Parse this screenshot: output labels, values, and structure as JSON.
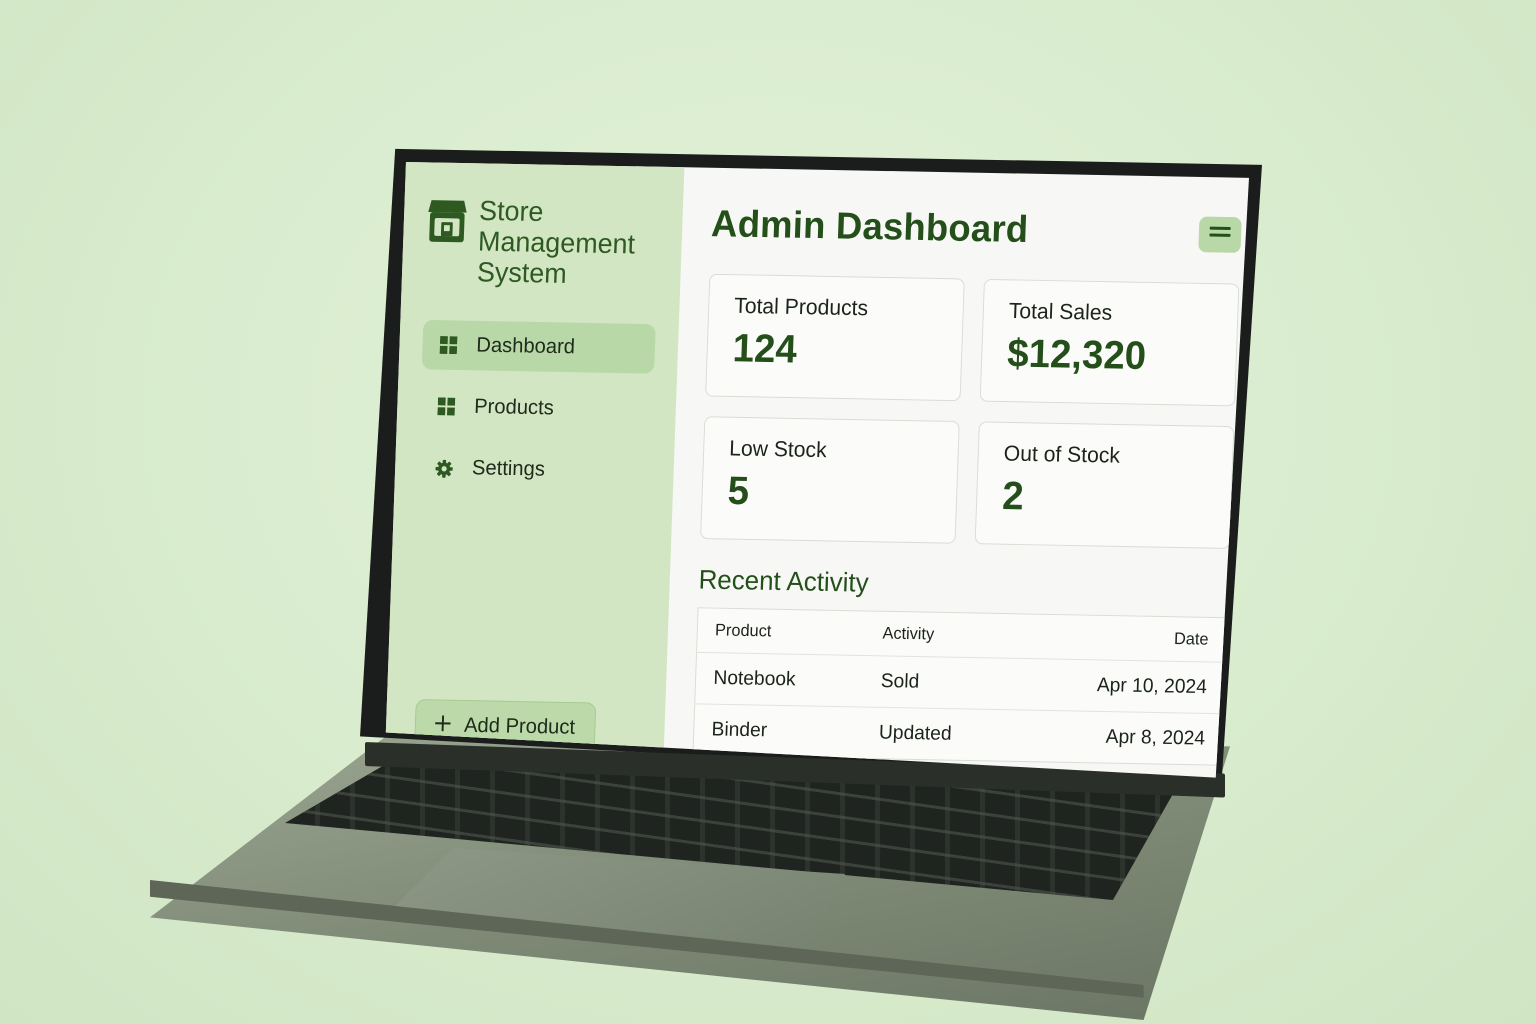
{
  "brand": {
    "title": "Store\nManagement\nSystem",
    "icon": "storefront-icon"
  },
  "nav": {
    "items": [
      {
        "label": "Dashboard",
        "icon": "grid-icon",
        "active": true
      },
      {
        "label": "Products",
        "icon": "grid-icon",
        "active": false
      },
      {
        "label": "Settings",
        "icon": "gear-icon",
        "active": false
      }
    ]
  },
  "sidebar": {
    "add_product_label": "Add Product",
    "add_icon": "plus-icon"
  },
  "header": {
    "title": "Admin Dashboard",
    "menu_icon": "hamburger-icon"
  },
  "stats": [
    {
      "label": "Total Products",
      "value": "124"
    },
    {
      "label": "Total Sales",
      "value": "$12,320"
    },
    {
      "label": "Low Stock",
      "value": "5"
    },
    {
      "label": "Out of Stock",
      "value": "2"
    }
  ],
  "activity": {
    "title": "Recent Activity",
    "columns": [
      "Product",
      "Activity",
      "Date"
    ],
    "rows": [
      {
        "product": "Notebook",
        "activity": "Sold",
        "date": "Apr 10, 2024"
      },
      {
        "product": "Binder",
        "activity": "Updated",
        "date": "Apr 8, 2024"
      }
    ]
  },
  "colors": {
    "accent": "#244f1a",
    "sidebar_bg": "#d2e6c4",
    "active_bg": "#b9d8a7",
    "background": "#dcedcf"
  }
}
